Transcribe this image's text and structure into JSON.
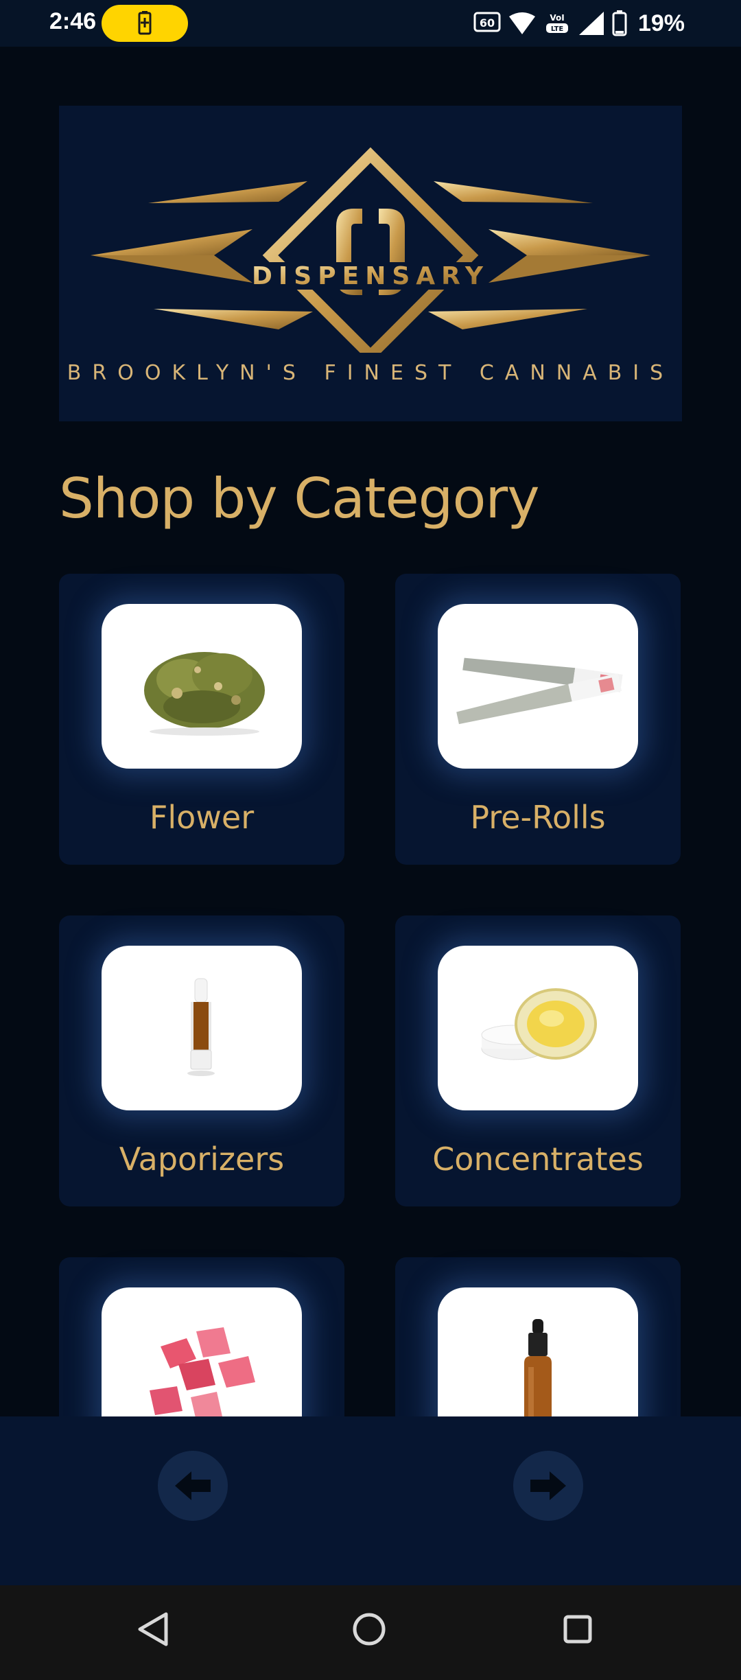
{
  "status_bar": {
    "time": "2:46",
    "battery_percent": "19%",
    "icons": [
      "battery-charging-icon",
      "refresh-rate-60hz-icon",
      "wifi-6-icon",
      "volte-icon",
      "signal-icon",
      "battery-icon"
    ]
  },
  "logo": {
    "word": "DISPENSARY",
    "tagline": "BROOKLYN'S FINEST CANNABIS",
    "gold": "#d8b067"
  },
  "section": {
    "title": "Shop by Category"
  },
  "categories": [
    {
      "label": "Flower",
      "icon": "flower-bud-image"
    },
    {
      "label": "Pre-Rolls",
      "icon": "pre-roll-image"
    },
    {
      "label": "Vaporizers",
      "icon": "vape-cartridge-image"
    },
    {
      "label": "Concentrates",
      "icon": "concentrate-jar-image"
    },
    {
      "label": "",
      "icon": "gummies-image"
    },
    {
      "label": "",
      "icon": "tincture-bottle-image"
    }
  ],
  "navigation": {
    "prev_icon": "arrow-left-icon",
    "next_icon": "arrow-right-icon"
  },
  "system_nav": [
    "back-icon",
    "home-icon",
    "recents-icon"
  ],
  "colors": {
    "background": "#030a14",
    "card": "#061530",
    "accent": "#d8b067"
  }
}
